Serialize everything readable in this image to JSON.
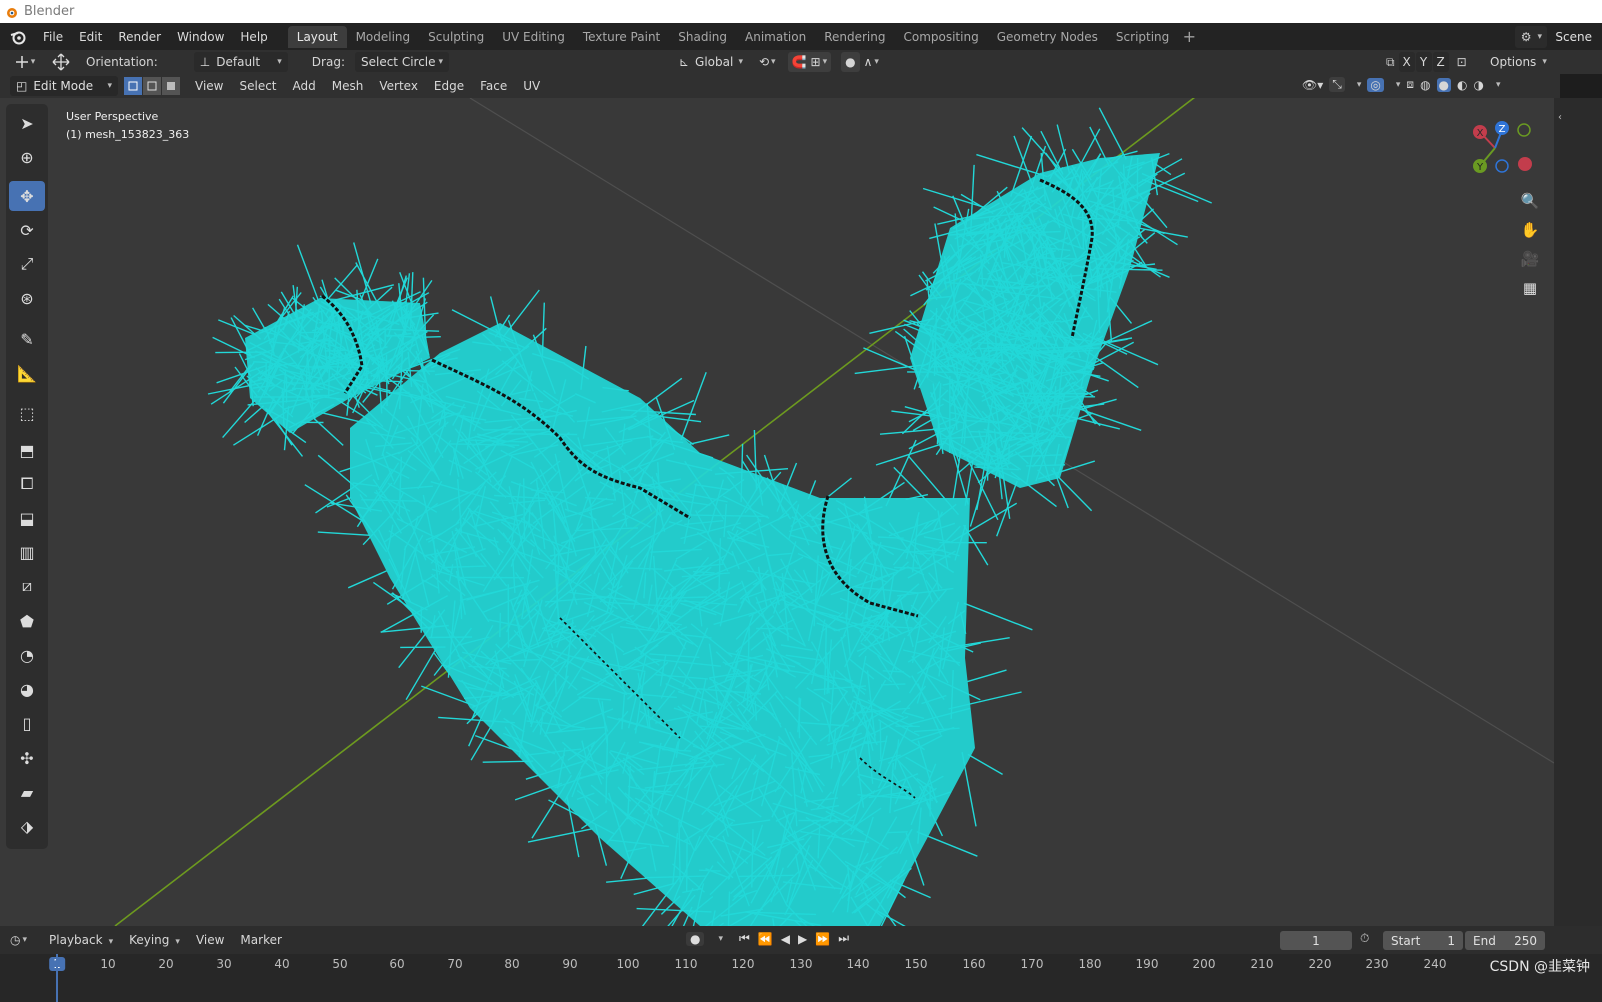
{
  "window": {
    "title": "Blender"
  },
  "menus": [
    "File",
    "Edit",
    "Render",
    "Window",
    "Help"
  ],
  "workspaces": [
    {
      "label": "Layout",
      "active": true
    },
    {
      "label": "Modeling"
    },
    {
      "label": "Sculpting"
    },
    {
      "label": "UV Editing"
    },
    {
      "label": "Texture Paint"
    },
    {
      "label": "Shading"
    },
    {
      "label": "Animation"
    },
    {
      "label": "Rendering"
    },
    {
      "label": "Compositing"
    },
    {
      "label": "Geometry Nodes"
    },
    {
      "label": "Scripting"
    }
  ],
  "scene": {
    "label": "Scene"
  },
  "tool_settings": {
    "orientation_label": "Orientation:",
    "orientation_value": "Default",
    "drag_label": "Drag:",
    "drag_value": "Select Circle",
    "transform_space": "Global",
    "axes": [
      "X",
      "Y",
      "Z"
    ],
    "options_label": "Options"
  },
  "viewport_header": {
    "mode": "Edit Mode",
    "menus": [
      "View",
      "Select",
      "Add",
      "Mesh",
      "Vertex",
      "Edge",
      "Face",
      "UV"
    ]
  },
  "viewport": {
    "perspective": "User Perspective",
    "object": "(1) mesh_153823_363",
    "gizmo_axes": [
      "X",
      "Y",
      "Z"
    ],
    "colors": {
      "normals": "#22d8d8",
      "floor_line": "#6d9a1f",
      "background": "#393939"
    }
  },
  "timeline": {
    "menus": [
      "Playback",
      "Keying",
      "View",
      "Marker"
    ],
    "current_frame": "1",
    "start_label": "Start",
    "start_value": "1",
    "end_label": "End",
    "end_value": "250",
    "ruler": [
      "1",
      "10",
      "20",
      "30",
      "40",
      "50",
      "60",
      "70",
      "80",
      "90",
      "100",
      "110",
      "120",
      "130",
      "140",
      "150",
      "160",
      "170",
      "180",
      "190",
      "200",
      "210",
      "220",
      "230",
      "240"
    ],
    "watermark": "CSDN @韭菜钟"
  }
}
